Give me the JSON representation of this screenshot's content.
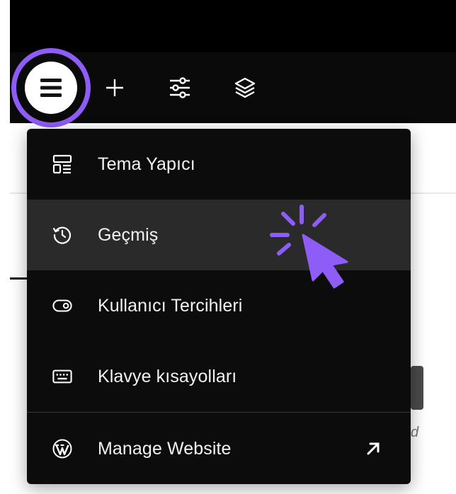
{
  "toolbar": {
    "menu_button": "menu-icon",
    "add_button": "plus-icon",
    "settings_button": "sliders-icon",
    "layers_button": "layers-icon",
    "accent": "#8e5cf7"
  },
  "menu": {
    "items": [
      {
        "label": "Tema Yapıcı",
        "icon": "layout-icon"
      },
      {
        "label": "Geçmiş",
        "icon": "history-icon"
      },
      {
        "label": "Kullanıcı Tercihleri",
        "icon": "toggle-icon"
      },
      {
        "label": "Klavye kısayolları",
        "icon": "keyboard-icon"
      },
      {
        "label": "Manage Website",
        "icon": "wordpress-icon",
        "external_icon": "arrow-up-right-icon"
      }
    ],
    "hover_index": 1
  },
  "background": {
    "partial_char": "d"
  }
}
